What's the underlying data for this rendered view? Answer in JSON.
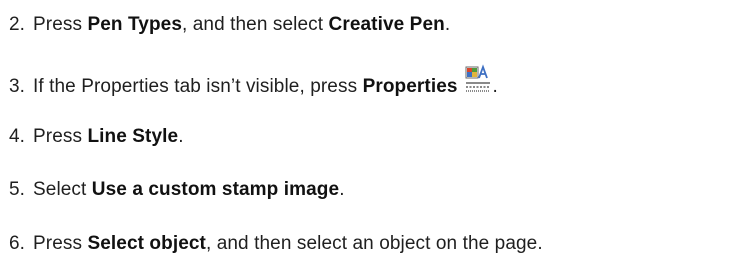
{
  "steps": [
    {
      "num": "2.",
      "t1": "Press ",
      "b1": "Pen Types",
      "t2": ", and then select ",
      "b2": "Creative Pen",
      "t3": "."
    },
    {
      "num": "3.",
      "t1": "If the Properties tab isn’t visible, press ",
      "b1": "Properties",
      "icon": "properties-icon",
      "t3": "."
    },
    {
      "num": "4.",
      "t1": "Press ",
      "b1": "Line Style",
      "t3": "."
    },
    {
      "num": "5.",
      "t1": "Select ",
      "b1": "Use a custom stamp image",
      "t3": "."
    },
    {
      "num": "6.",
      "t1": "Press ",
      "b1": "Select object",
      "t2": ", and then select an object on the page."
    }
  ],
  "colors": {
    "text": "#1f1f1f",
    "icon_red": "#d9452b",
    "icon_green": "#4f9a3a",
    "icon_blue": "#3d6fc2",
    "icon_yellow": "#e2b43a"
  }
}
